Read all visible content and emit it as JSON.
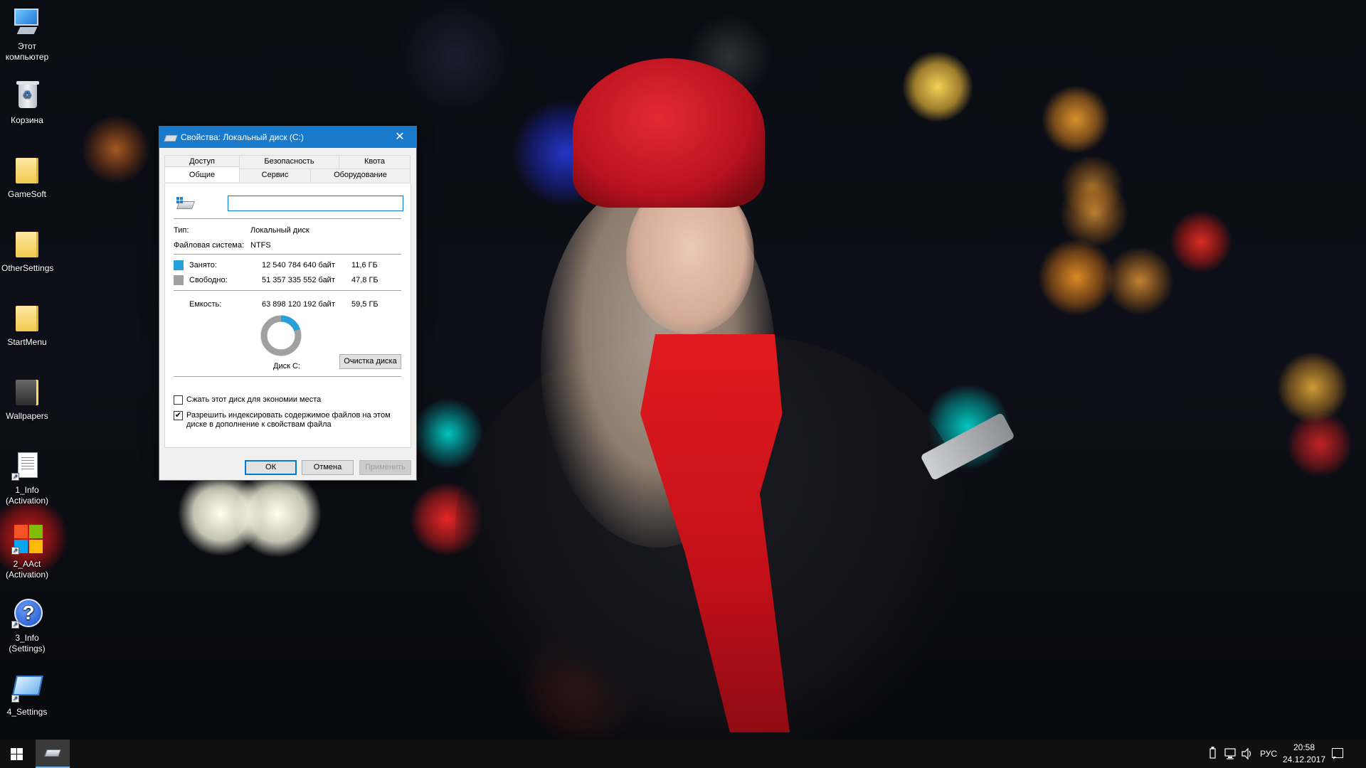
{
  "desktop": {
    "icons": [
      {
        "label": "Этот компьютер",
        "icon": "this-pc-icon"
      },
      {
        "label": "Корзина",
        "icon": "recycle-bin-icon"
      },
      {
        "label": "GameSoft",
        "icon": "folder-icon"
      },
      {
        "label": "OtherSettings",
        "icon": "folder-icon"
      },
      {
        "label": "StartMenu",
        "icon": "folder-icon"
      },
      {
        "label": "Wallpapers",
        "icon": "folder-icon"
      },
      {
        "label": "1_Info (Activation)",
        "icon": "text-document-icon"
      },
      {
        "label": "2_AAct (Activation)",
        "icon": "windows-logo-icon"
      },
      {
        "label": "3_Info (Settings)",
        "icon": "help-icon"
      },
      {
        "label": "4_Settings",
        "icon": "settings-icon"
      }
    ]
  },
  "dialog": {
    "title": "Свойства: Локальный диск (C:)",
    "close_glyph": "✕",
    "tabs_top": [
      "Доступ",
      "Безопасность",
      "Квота"
    ],
    "tabs_bottom": [
      "Общие",
      "Сервис",
      "Оборудование"
    ],
    "selected_tab": "Общие",
    "label_value": "",
    "type_label": "Тип:",
    "type_value": "Локальный диск",
    "fs_label": "Файловая система:",
    "fs_value": "NTFS",
    "used_label": "Занято:",
    "used_bytes": "12 540 784 640 байт",
    "used_gb": "11,6 ГБ",
    "free_label": "Свободно:",
    "free_bytes": "51 357 335 552 байт",
    "free_gb": "47,8 ГБ",
    "capacity_label": "Емкость:",
    "capacity_bytes": "63 898 120 192 байт",
    "capacity_gb": "59,5 ГБ",
    "used_fraction": 0.196,
    "used_color": "#26a0da",
    "free_color": "#a0a0a0",
    "disk_label": "Диск C:",
    "cleanup_button": "Очистка диска",
    "compress_checkbox": "Сжать этот диск для экономии места",
    "compress_checked": false,
    "index_checkbox_line1": "Разрешить индексировать содержимое файлов на этом",
    "index_checkbox_line2": "диске в дополнение к свойствам файла",
    "index_checked": true,
    "ok_button": "ОК",
    "cancel_button": "Отмена",
    "apply_button": "Применить"
  },
  "taskbar": {
    "language": "РУС",
    "time": "20:58",
    "date": "24.12.2017",
    "tray_icons": [
      "usb-icon",
      "network-icon",
      "volume-icon"
    ],
    "accent_color": "#76b9ed"
  }
}
